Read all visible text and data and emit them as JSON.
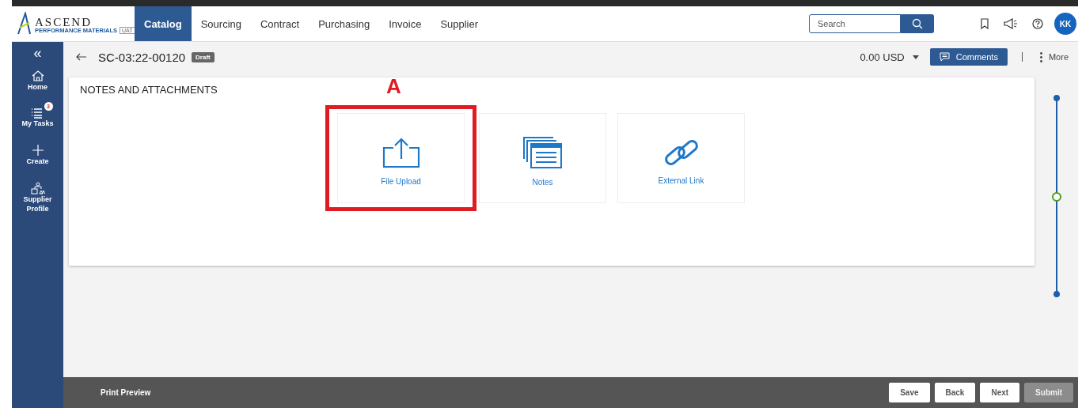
{
  "logo": {
    "name": "ASCEND",
    "tagline": "PERFORMANCE MATERIALS",
    "badge": "UAT"
  },
  "nav": [
    {
      "label": "Catalog",
      "selected": true
    },
    {
      "label": "Sourcing",
      "selected": false
    },
    {
      "label": "Contract",
      "selected": false
    },
    {
      "label": "Purchasing",
      "selected": false
    },
    {
      "label": "Invoice",
      "selected": false
    },
    {
      "label": "Supplier",
      "selected": false
    }
  ],
  "search": {
    "placeholder": "Search"
  },
  "avatar": "KK",
  "sidebar": {
    "collapse": "«",
    "items": [
      {
        "label": "Home",
        "kind": "home"
      },
      {
        "label": "My Tasks",
        "kind": "tasks",
        "badge": "3"
      },
      {
        "label": "Create",
        "kind": "create"
      },
      {
        "label": "Supplier Profile",
        "kind": "profile"
      }
    ]
  },
  "document": {
    "id": "SC-03:22-00120",
    "status": "Draft",
    "total": "0.00 USD",
    "comments": "Comments",
    "more": "More"
  },
  "section": {
    "title": "NOTES AND ATTACHMENTS",
    "annotation": "A",
    "cards": [
      {
        "label": "File Upload",
        "kind": "upload",
        "highlighted": true
      },
      {
        "label": "Notes",
        "kind": "notes",
        "highlighted": false
      },
      {
        "label": "External Link",
        "kind": "link",
        "highlighted": false
      }
    ]
  },
  "footer": {
    "print_preview": "Print Preview",
    "buttons": [
      {
        "label": "Save",
        "disabled": false
      },
      {
        "label": "Back",
        "disabled": false
      },
      {
        "label": "Next",
        "disabled": false
      },
      {
        "label": "Submit",
        "disabled": true
      }
    ]
  }
}
